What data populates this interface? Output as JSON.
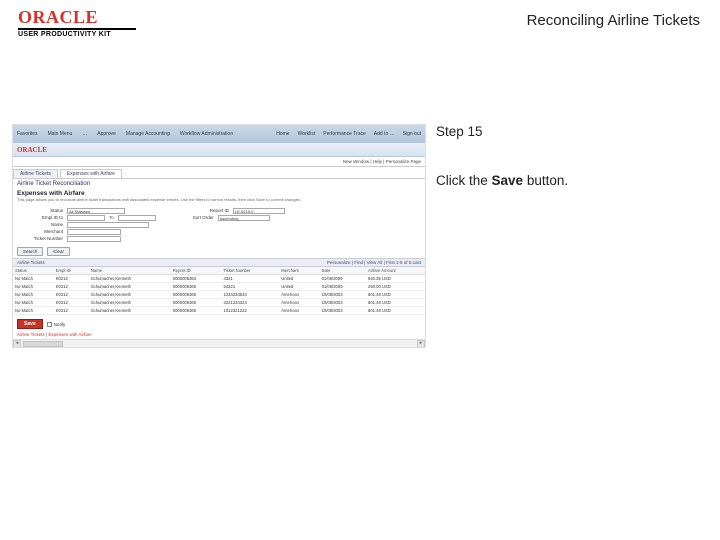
{
  "header": {
    "brand": "ORACLE",
    "subbrand": "USER PRODUCTIVITY KIT",
    "doc_title": "Reconciling Airline Tickets"
  },
  "instructions": {
    "step_label": "Step 15",
    "line1_a": "Click the ",
    "line1_b": "Save",
    "line1_c": " button."
  },
  "app": {
    "topbar_left": [
      "Favorites",
      "Main Menu",
      "…",
      "Approve",
      "Manage Accounting",
      "Workflow Administration"
    ],
    "topbar_right": [
      "Home",
      "Worklist",
      "Performance Trace",
      "Add to …",
      "Sign out"
    ],
    "oracle": "ORACLE",
    "linkbar": "New Window | Help | Personalize Page",
    "tabs": [
      "Airline Tickets",
      "Expenses with Airfare"
    ],
    "section_title": "Airline Ticket Reconciliation",
    "subhead": "Expenses with Airfare",
    "help_text": "This page allows you to reconcile airline ticket transactions with associated expense entries. Use the filters to narrow results, then click Save to commit changes.",
    "form": {
      "statusLabel": "Status",
      "status_val": "All Statuses",
      "emplLabel": "Empl ID to",
      "toLabel": "To",
      "nameLabel": "Name",
      "merchantLabel": "Merchant",
      "ticketLabel": "Ticket Number",
      "reportLabel": "Report ID",
      "sortLabel": "Sort Order",
      "reportVal": "LE 0219-0",
      "sortVal": "Ascending"
    },
    "buttons": {
      "search": "Search",
      "clear": "Clear"
    },
    "grid_title": "Airline Tickets",
    "grid_tools": "Personalize | Find | View All | First 1-5 of 5 Last",
    "columns": [
      "Status",
      "Empl ID",
      "Name",
      "Report ID",
      "Ticket Number",
      "Merchant",
      "Date",
      "Airfare Amount"
    ],
    "rows": [
      {
        "status": "No Match",
        "emp": "K0212",
        "name": "Schumacher,Kenneth",
        "rep": "0000006363",
        "ticket": "4321",
        "merch": "United",
        "date": "01/06/2009",
        "amt": "940.35 USD"
      },
      {
        "status": "No Match",
        "emp": "K0212",
        "name": "Schumacher,Kenneth",
        "rep": "0000006365",
        "ticket": "54321",
        "merch": "United",
        "date": "01/06/2009",
        "amt": "250.00 USD"
      },
      {
        "status": "No Match",
        "emp": "K0212",
        "name": "Schumacher,Kenneth",
        "rep": "0000006365",
        "ticket": "1234234534",
        "merch": "American",
        "date": "10/08/2003",
        "amt": "801.48 USD"
      },
      {
        "status": "No Match",
        "emp": "K0212",
        "name": "Schumacher,Kenneth",
        "rep": "0000006365",
        "ticket": "3221234324",
        "merch": "American",
        "date": "10/08/2003",
        "amt": "801.48 USD"
      },
      {
        "status": "No Match",
        "emp": "K0212",
        "name": "Schumacher,Kenneth",
        "rep": "0000006365",
        "ticket": "1012321222",
        "merch": "American",
        "date": "10/08/2003",
        "amt": "801.48 USD"
      }
    ],
    "save": "Save",
    "notify": "Notify",
    "bottom_link": "Airline Tickets | Expenses with Airfare"
  }
}
